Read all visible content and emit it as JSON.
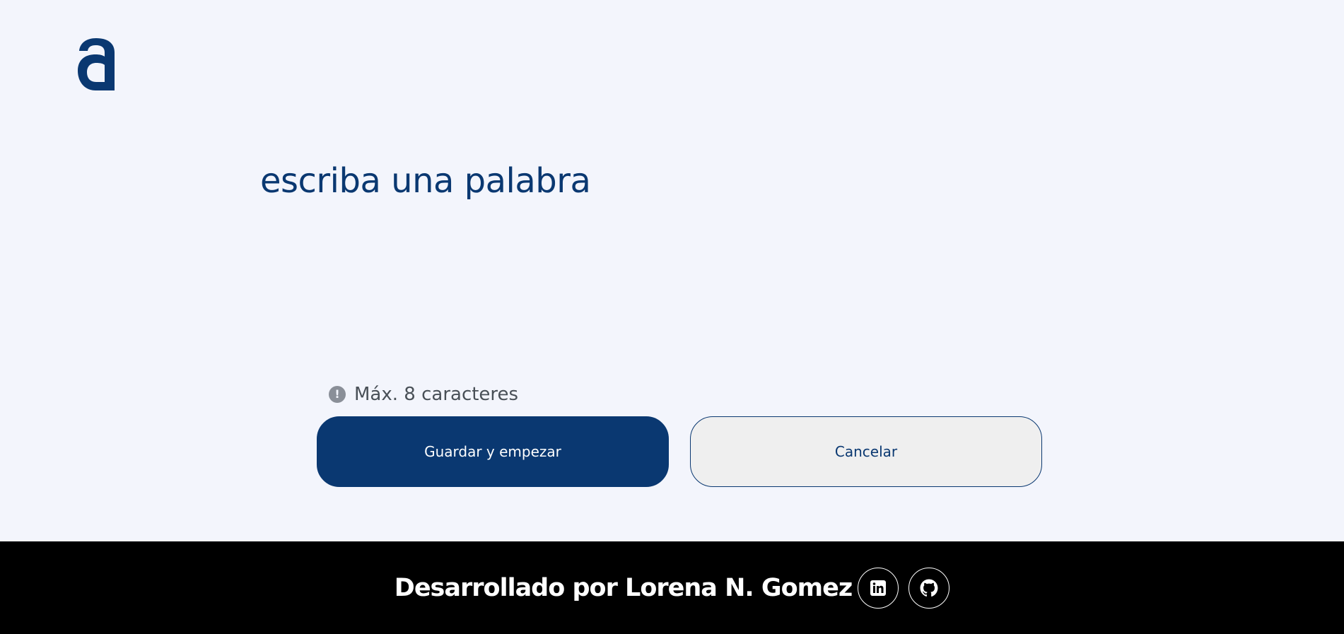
{
  "header": {
    "logo_icon": "alura-a-logo"
  },
  "main": {
    "input_placeholder": "escriba una palabra",
    "input_value": "",
    "hint_icon": "exclamation-circle-icon",
    "hint_text": "Máx. 8 caracteres",
    "save_label": "Guardar y empezar",
    "cancel_label": "Cancelar"
  },
  "footer": {
    "credit_text": "Desarrollado por Lorena N. Gomez",
    "links": [
      {
        "icon": "linkedin-icon"
      },
      {
        "icon": "github-icon"
      }
    ]
  },
  "colors": {
    "background": "#F3F5FC",
    "accent": "#0A3871",
    "secondary_button": "#EFEFEF",
    "footer_background": "#000000",
    "hint_text": "#495057"
  }
}
